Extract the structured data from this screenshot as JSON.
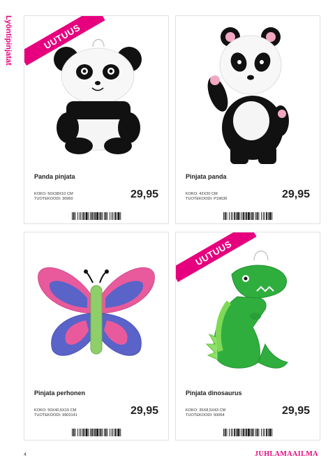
{
  "section_label": "Lyöntipinjatat",
  "badge_text": "UUTUUS",
  "page_number": "4",
  "brand": "JUHLAMAAILMA",
  "accent_color": "#e6007e",
  "products": [
    {
      "name": "Panda pinjata",
      "size": "KOKO: 50X38X10 CM",
      "code": "TUOTEKOODI: 30960",
      "price": "29,95",
      "badge": true,
      "image": "panda-pinata-hanging"
    },
    {
      "name": "Pinjata panda",
      "size": "KOKO: 42X20 CM",
      "code": "TUOTEKOODI: P19636",
      "price": "29,95",
      "badge": false,
      "image": "panda-pinata-standing"
    },
    {
      "name": "Pinjata perhonen",
      "size": "KOKO: 50X40,5X10 CM",
      "code": "TUOTEKOODI: 9903141",
      "price": "29,95",
      "badge": false,
      "image": "butterfly-pinata"
    },
    {
      "name": "Pinjata dinosaurus",
      "size": "KOKO: 35X8,5X43 CM",
      "code": "TUOTEKOODI: 50064",
      "price": "29,95",
      "badge": true,
      "image": "dinosaur-pinata"
    }
  ]
}
